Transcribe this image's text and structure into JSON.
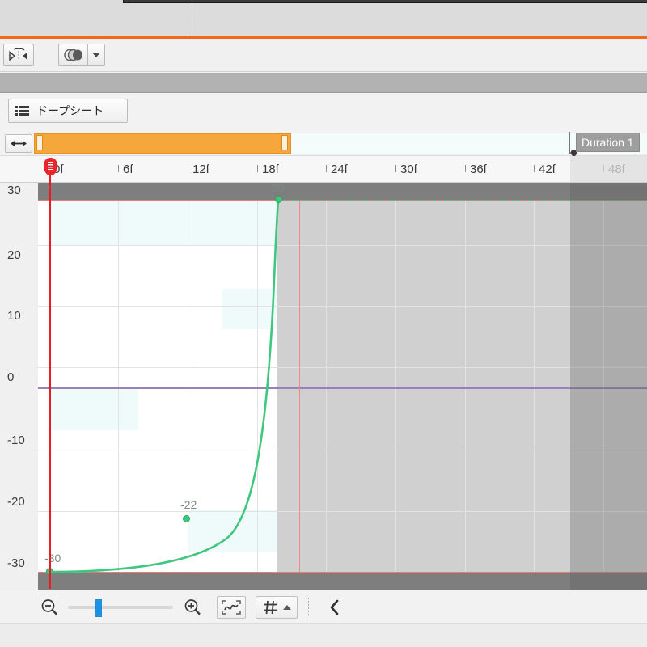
{
  "app": {
    "panel_title": "ドープシート",
    "duration_label": "Duration 1"
  },
  "toolbar": {
    "mirror_icon": "mirror-flip-icon",
    "onion_icon": "onion-skin-icon",
    "onion_dropdown_icon": "chevron-down-icon"
  },
  "sheet_button": {
    "label": "ドープシート",
    "icon": "list-icon"
  },
  "range_bar": {
    "resize_icon": "horizontal-resize-icon",
    "start_frame": 0,
    "end_frame": 18
  },
  "ruler": {
    "unit_suffix": "f",
    "ticks": [
      {
        "label": "0f",
        "frame": 0,
        "dim": false
      },
      {
        "label": "6f",
        "frame": 6,
        "dim": false
      },
      {
        "label": "12f",
        "frame": 12,
        "dim": false
      },
      {
        "label": "18f",
        "frame": 18,
        "dim": false
      },
      {
        "label": "24f",
        "frame": 24,
        "dim": false
      },
      {
        "label": "30f",
        "frame": 30,
        "dim": false
      },
      {
        "label": "36f",
        "frame": 36,
        "dim": false
      },
      {
        "label": "42f",
        "frame": 42,
        "dim": false
      },
      {
        "label": "48f",
        "frame": 48,
        "dim": true
      }
    ],
    "playhead_frame": 0
  },
  "bottom_toolbar": {
    "zoom_out_icon": "zoom-out-icon",
    "zoom_in_icon": "zoom-in-icon",
    "fit_curve_icon": "fit-curve-icon",
    "grid_snap_icon": "grid-snap-icon",
    "grid_snap_arrow_icon": "chevron-up-icon",
    "collapse_icon": "chevron-left-icon",
    "zoom_slider_value": 26
  },
  "colors": {
    "accent_orange": "#f4661b",
    "range_orange": "#f5a73c",
    "curve_green": "#3fc77f",
    "playhead_red": "#ea1d23",
    "zero_line_purple": "#9b7fb8",
    "limit_line_red": "#e87b7b",
    "slider_blue": "#1f8fe0"
  },
  "chart_data": {
    "type": "line",
    "title": "",
    "xlabel": "",
    "ylabel": "",
    "xlim": [
      -4,
      52
    ],
    "ylim": [
      -34,
      34
    ],
    "y_ticks": [
      30,
      20,
      10,
      0,
      -10,
      -20,
      -30
    ],
    "y_tick_labels": [
      "30",
      "20",
      "10",
      "0",
      "-10",
      "-20",
      "-30"
    ],
    "x_ticks": [
      0,
      6,
      12,
      18,
      24,
      30,
      36,
      42,
      48
    ],
    "x_tick_labels": [
      "0f",
      "6f",
      "12f",
      "18f",
      "24f",
      "30f",
      "36f",
      "42f",
      "48f"
    ],
    "grid": true,
    "legend": "none",
    "series": [
      {
        "name": "curve",
        "color": "#3fc77f",
        "interpolation": "ease-in",
        "keyframes": [
          {
            "frame": 0,
            "value": -30,
            "label": "-30"
          },
          {
            "frame": 12,
            "value": -22,
            "label": "-22"
          },
          {
            "frame": 18,
            "value": 30,
            "label": "30"
          }
        ]
      }
    ],
    "annotations": [
      {
        "text": "-30",
        "frame": 0,
        "value": -30
      },
      {
        "text": "-22",
        "frame": 12,
        "value": -22
      },
      {
        "text": "30",
        "frame": 18,
        "value": 30
      }
    ],
    "value_limits": {
      "upper": 30,
      "lower": -30
    },
    "zero_line": 0,
    "playhead_frame": 0,
    "shaded_after_frame": 18,
    "duration_frame": 45
  }
}
